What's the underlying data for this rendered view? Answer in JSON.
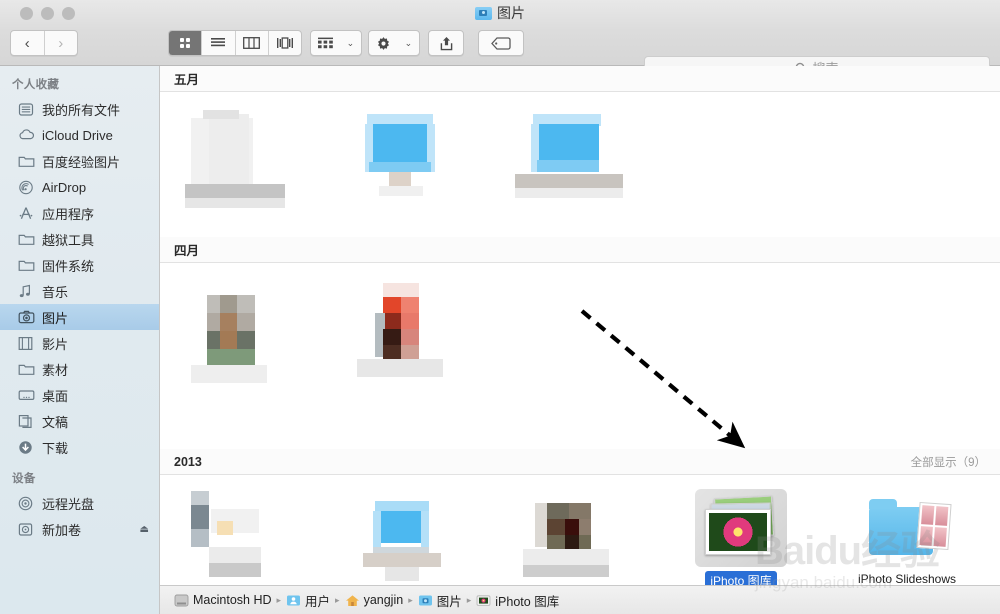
{
  "window": {
    "title": "图片",
    "title_icon": "camera-folder-icon",
    "traffic_lights": [
      "close-button",
      "minimize-button",
      "zoom-button"
    ]
  },
  "toolbar": {
    "back_label": "‹",
    "forward_label": "›",
    "views": [
      {
        "name": "icon-view",
        "label": "▦",
        "selected": true
      },
      {
        "name": "list-view",
        "label": "≡",
        "selected": false
      },
      {
        "name": "column-view",
        "label": "▥",
        "selected": false
      },
      {
        "name": "coverflow-view",
        "label": "▯",
        "selected": false
      }
    ],
    "arrange_label": "▤",
    "action_label": "✱",
    "share_label": "⬆",
    "tag_label": "🏷",
    "chevron": "⌄"
  },
  "search": {
    "placeholder": "搜索",
    "value": "",
    "icon": "search-icon"
  },
  "sidebar": {
    "sections": [
      {
        "header": "个人收藏",
        "items": [
          {
            "label": "我的所有文件",
            "icon": "all-files-icon",
            "selected": false
          },
          {
            "label": "iCloud Drive",
            "icon": "cloud-icon",
            "selected": false
          },
          {
            "label": "百度经验图片",
            "icon": "folder-icon",
            "selected": false
          },
          {
            "label": "AirDrop",
            "icon": "airdrop-icon",
            "selected": false
          },
          {
            "label": "应用程序",
            "icon": "applications-icon",
            "selected": false
          },
          {
            "label": "越狱工具",
            "icon": "folder-icon",
            "selected": false
          },
          {
            "label": "固件系统",
            "icon": "folder-icon",
            "selected": false
          },
          {
            "label": "音乐",
            "icon": "music-note-icon",
            "selected": false
          },
          {
            "label": "图片",
            "icon": "camera-icon",
            "selected": true
          },
          {
            "label": "影片",
            "icon": "film-icon",
            "selected": false
          },
          {
            "label": "素材",
            "icon": "folder-icon",
            "selected": false
          },
          {
            "label": "桌面",
            "icon": "desktop-icon",
            "selected": false
          },
          {
            "label": "文稿",
            "icon": "documents-icon",
            "selected": false
          },
          {
            "label": "下载",
            "icon": "download-icon",
            "selected": false
          }
        ]
      },
      {
        "header": "设备",
        "items": [
          {
            "label": "远程光盘",
            "icon": "optical-disc-icon",
            "selected": false
          },
          {
            "label": "新加卷",
            "icon": "hard-disk-icon",
            "selected": false,
            "eject": "⏏"
          }
        ]
      }
    ]
  },
  "content": {
    "groups": [
      {
        "title": "五月",
        "show_all": "",
        "items": [
          {
            "name": "blurred-thumbnail",
            "label": ""
          },
          {
            "name": "blurred-thumbnail",
            "label": ""
          },
          {
            "name": "blurred-thumbnail",
            "label": ""
          }
        ]
      },
      {
        "title": "四月",
        "show_all": "",
        "items": [
          {
            "name": "blurred-thumbnail",
            "label": ""
          },
          {
            "name": "blurred-thumbnail",
            "label": ""
          }
        ]
      },
      {
        "title": "2013",
        "show_all": "全部显示（9）",
        "items": [
          {
            "name": "blurred-thumbnail",
            "label": ""
          },
          {
            "name": "blurred-thumbnail",
            "label": ""
          },
          {
            "name": "blurred-thumbnail",
            "label": ""
          },
          {
            "name": "iphoto-library",
            "label": "iPhoto 图库",
            "selected": true
          },
          {
            "name": "iphoto-slideshows",
            "label": "iPhoto Slideshows",
            "selected": false
          }
        ]
      }
    ]
  },
  "pathbar": {
    "crumbs": [
      {
        "label": "Macintosh HD",
        "icon": "hard-disk-icon"
      },
      {
        "label": "用户",
        "icon": "users-folder-icon"
      },
      {
        "label": "yangjin",
        "icon": "home-icon"
      },
      {
        "label": "图片",
        "icon": "camera-folder-icon"
      },
      {
        "label": "iPhoto 图库",
        "icon": "iphoto-icon"
      }
    ],
    "separator": "▸"
  },
  "annotation": {
    "type": "dashed-arrow",
    "points_to": "iPhoto 图库"
  },
  "watermark": {
    "brand": "Baidu经验",
    "url": "jingyan.baidu.com"
  },
  "colors": {
    "selection_blue": "#2a6fd6",
    "sidebar_selected": "#b1d1ea",
    "accent": "#56b6ea"
  }
}
